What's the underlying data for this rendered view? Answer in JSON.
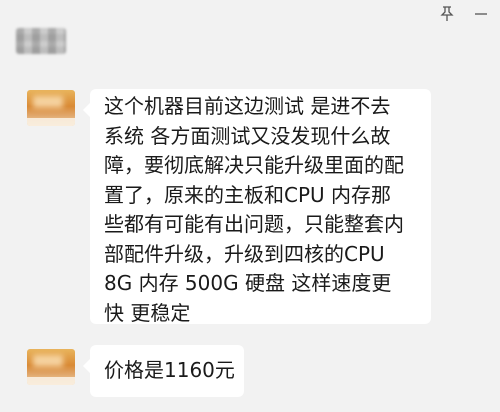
{
  "chat_header": {
    "contact_name": "",
    "pin_icon": "pin-icon",
    "minimize_icon": "minimize-icon"
  },
  "messages": [
    {
      "avatar": "avatar",
      "text": "这个机器目前这边测试 是进不去\n系统 各方面测试又没发现什么故\n障，要彻底解决只能升级里面的配\n置了，原来的主板和CPU 内存那\n些都有可能有出问题，只能整套内\n部配件升级，升级到四核的CPU\n8G 内存 500G 硬盘 这样速度更\n快 更稳定"
    },
    {
      "avatar": "avatar",
      "text": "价格是1160元"
    }
  ]
}
